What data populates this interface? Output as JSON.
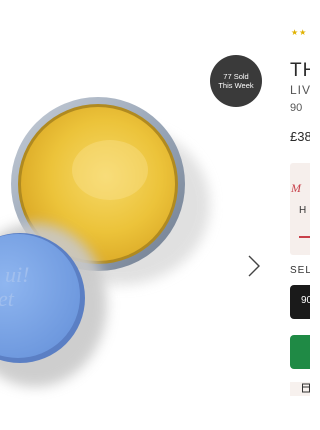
{
  "gallery": {
    "badge_line1": "77 Sold",
    "badge_line2": "This Week",
    "next_icon": "chevron-right-icon"
  },
  "product": {
    "rating_stars": "★★",
    "title": "TH",
    "subtitle": "LIV",
    "size": "90",
    "price": "£38"
  },
  "promo": {
    "logo_text": "M",
    "text": "H"
  },
  "size_selector": {
    "label": "SEL",
    "selected_option": "90"
  },
  "colors": {
    "balm_yellow": "#efc236",
    "lid_blue": "#7fa8e8",
    "badge_bg": "#3a3a3a",
    "cta_green": "#1f8a45",
    "stars": "#e0b100"
  }
}
